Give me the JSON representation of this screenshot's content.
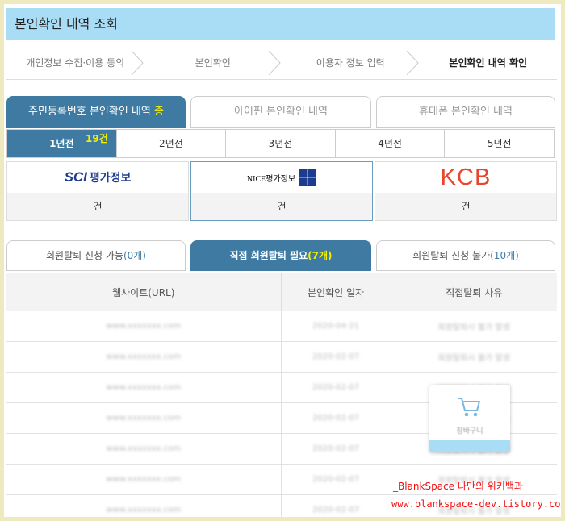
{
  "page_title": "본인확인 내역 조회",
  "steps": [
    "개인정보 수집·이용 동의",
    "본인확인",
    "이용자 정보 입력",
    "본인확인 내역 확인"
  ],
  "main_tabs": {
    "resident": {
      "label": "주민등록번호 본인확인 내역",
      "suffix": "총"
    },
    "ipin": "아이핀 본인확인 내역",
    "phone": "휴대폰 본인확인 내역"
  },
  "years": [
    "1년전",
    "2년전",
    "3년전",
    "4년전",
    "5년전"
  ],
  "year_count": "19건",
  "bureaus": [
    {
      "name": "SCI평가정보",
      "logo_main": "SCI",
      "logo_sub": "평가정보",
      "count": "건"
    },
    {
      "name": "NICE평가정보",
      "logo_main": "NICE평가정보",
      "count": "건"
    },
    {
      "name": "KCB",
      "logo_main": "KCB",
      "count": "건"
    }
  ],
  "member_tabs": {
    "possible": {
      "label": "회원탈퇴 신청 가능",
      "count": "(0개)"
    },
    "direct": {
      "label": "직접 회원탈퇴 필요",
      "count": "(7개)"
    },
    "impossible": {
      "label": "회원탈퇴 신청 불가",
      "count": "(10개)"
    }
  },
  "table": {
    "headers": [
      "웹사이트(URL)",
      "본인확인 일자",
      "직접탈퇴 사유"
    ],
    "rows": [
      [
        "www.xxxxxxx.com",
        "2020-04-21",
        "회원탈퇴시 불가 발생"
      ],
      [
        "www.xxxxxxx.com",
        "2020-02-07",
        "회원탈퇴시 불가 발생"
      ],
      [
        "www.xxxxxxx.com",
        "2020-02-07",
        "회원탈퇴시 불가 발생"
      ],
      [
        "www.xxxxxxx.com",
        "2020-02-07",
        "회원탈퇴시 불가 발생"
      ],
      [
        "www.xxxxxxx.com",
        "2020-02-07",
        "회원탈퇴시 불가 발생"
      ],
      [
        "www.xxxxxxx.com",
        "2020-02-07",
        "회원탈퇴시 불가 발생"
      ],
      [
        "www.xxxxxxx.com",
        "2020-02-07",
        "회원탈퇴시 불가 발생"
      ]
    ]
  },
  "popup": {
    "label": "장바구니",
    "icon": "cart-icon"
  },
  "watermark": {
    "line1": "_BlankSpace 나만의 위키백과",
    "line2": "www.blankspace-dev.tistory.com"
  },
  "colors": {
    "accent": "#3e7aa1",
    "title_bg": "#a9dcf5",
    "highlight": "#f4f000",
    "watermark": "#f21010",
    "kcb_red": "#e8442f",
    "sci_blue": "#1d3c8f"
  }
}
